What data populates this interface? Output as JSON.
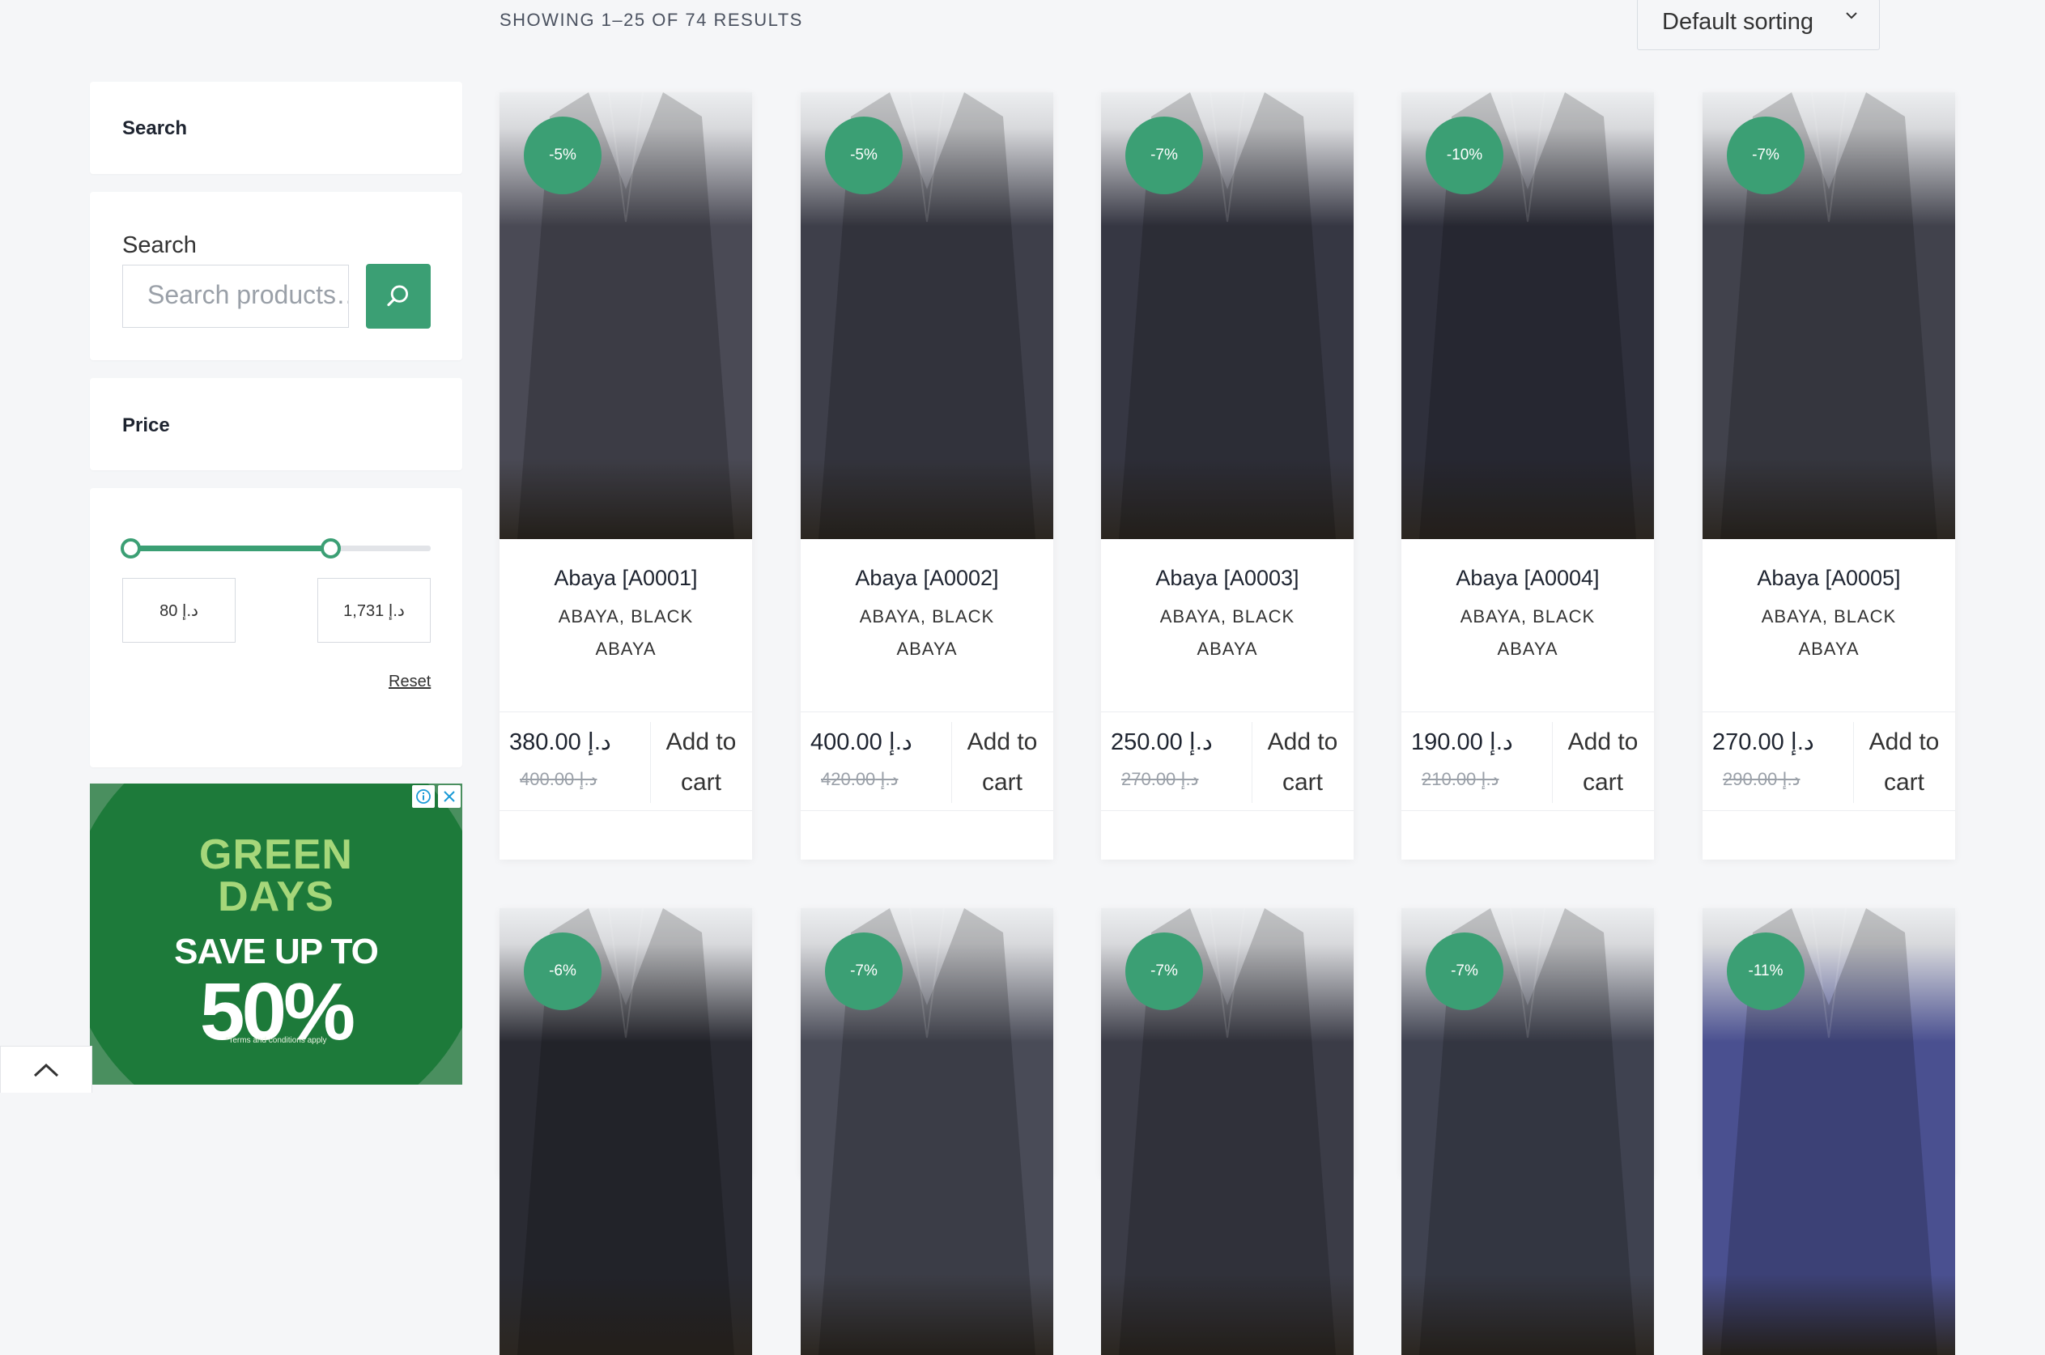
{
  "toolbar": {
    "result_count": "SHOWING 1–25 OF 74 RESULTS",
    "sort_selected": "Default sorting"
  },
  "sidebar": {
    "search_widget_title": "Search",
    "search_label": "Search",
    "search_placeholder": "Search products…",
    "price_widget_title": "Price",
    "price_min": "80 د.إ",
    "price_max": "1,731 د.إ",
    "price_range_fraction": [
      0,
      0.67
    ],
    "reset_label": "Reset"
  },
  "ad": {
    "line1": "GREEN",
    "line2": "DAYS",
    "save_text": "SAVE UP TO",
    "percent": "50%",
    "terms": "*Terms and conditions apply"
  },
  "colors": {
    "accent": "#3b9f74",
    "background": "#f5f6f8"
  },
  "products": [
    {
      "badge": "-5%",
      "title": "Abaya [A0001]",
      "categories": "ABAYA, BLACK ABAYA",
      "price": "د.إ 380.00",
      "old_price": "د.إ 400.00",
      "add_to_cart": "Add to cart",
      "tone": "#4a4a55"
    },
    {
      "badge": "-5%",
      "title": "Abaya [A0002]",
      "categories": "ABAYA, BLACK ABAYA",
      "price": "د.إ 400.00",
      "old_price": "د.إ 420.00",
      "add_to_cart": "Add to cart",
      "tone": "#3e3f4a"
    },
    {
      "badge": "-7%",
      "title": "Abaya [A0003]",
      "categories": "ABAYA, BLACK ABAYA",
      "price": "د.إ 250.00",
      "old_price": "د.إ 270.00",
      "add_to_cart": "Add to cart",
      "tone": "#363743"
    },
    {
      "badge": "-10%",
      "title": "Abaya [A0004]",
      "categories": "ABAYA, BLACK ABAYA",
      "price": "د.إ 190.00",
      "old_price": "د.إ 210.00",
      "add_to_cart": "Add to cart",
      "tone": "#2f303c"
    },
    {
      "badge": "-7%",
      "title": "Abaya [A0005]",
      "categories": "ABAYA, BLACK ABAYA",
      "price": "د.إ 270.00",
      "old_price": "د.إ 290.00",
      "add_to_cart": "Add to cart",
      "tone": "#41424c"
    },
    {
      "badge": "-6%",
      "tone": "#2a2b33"
    },
    {
      "badge": "-7%",
      "tone": "#494b57"
    },
    {
      "badge": "-7%",
      "tone": "#3b3c47"
    },
    {
      "badge": "-7%",
      "tone": "#3f4250"
    },
    {
      "badge": "-11%",
      "tone": "#4a5090"
    }
  ]
}
